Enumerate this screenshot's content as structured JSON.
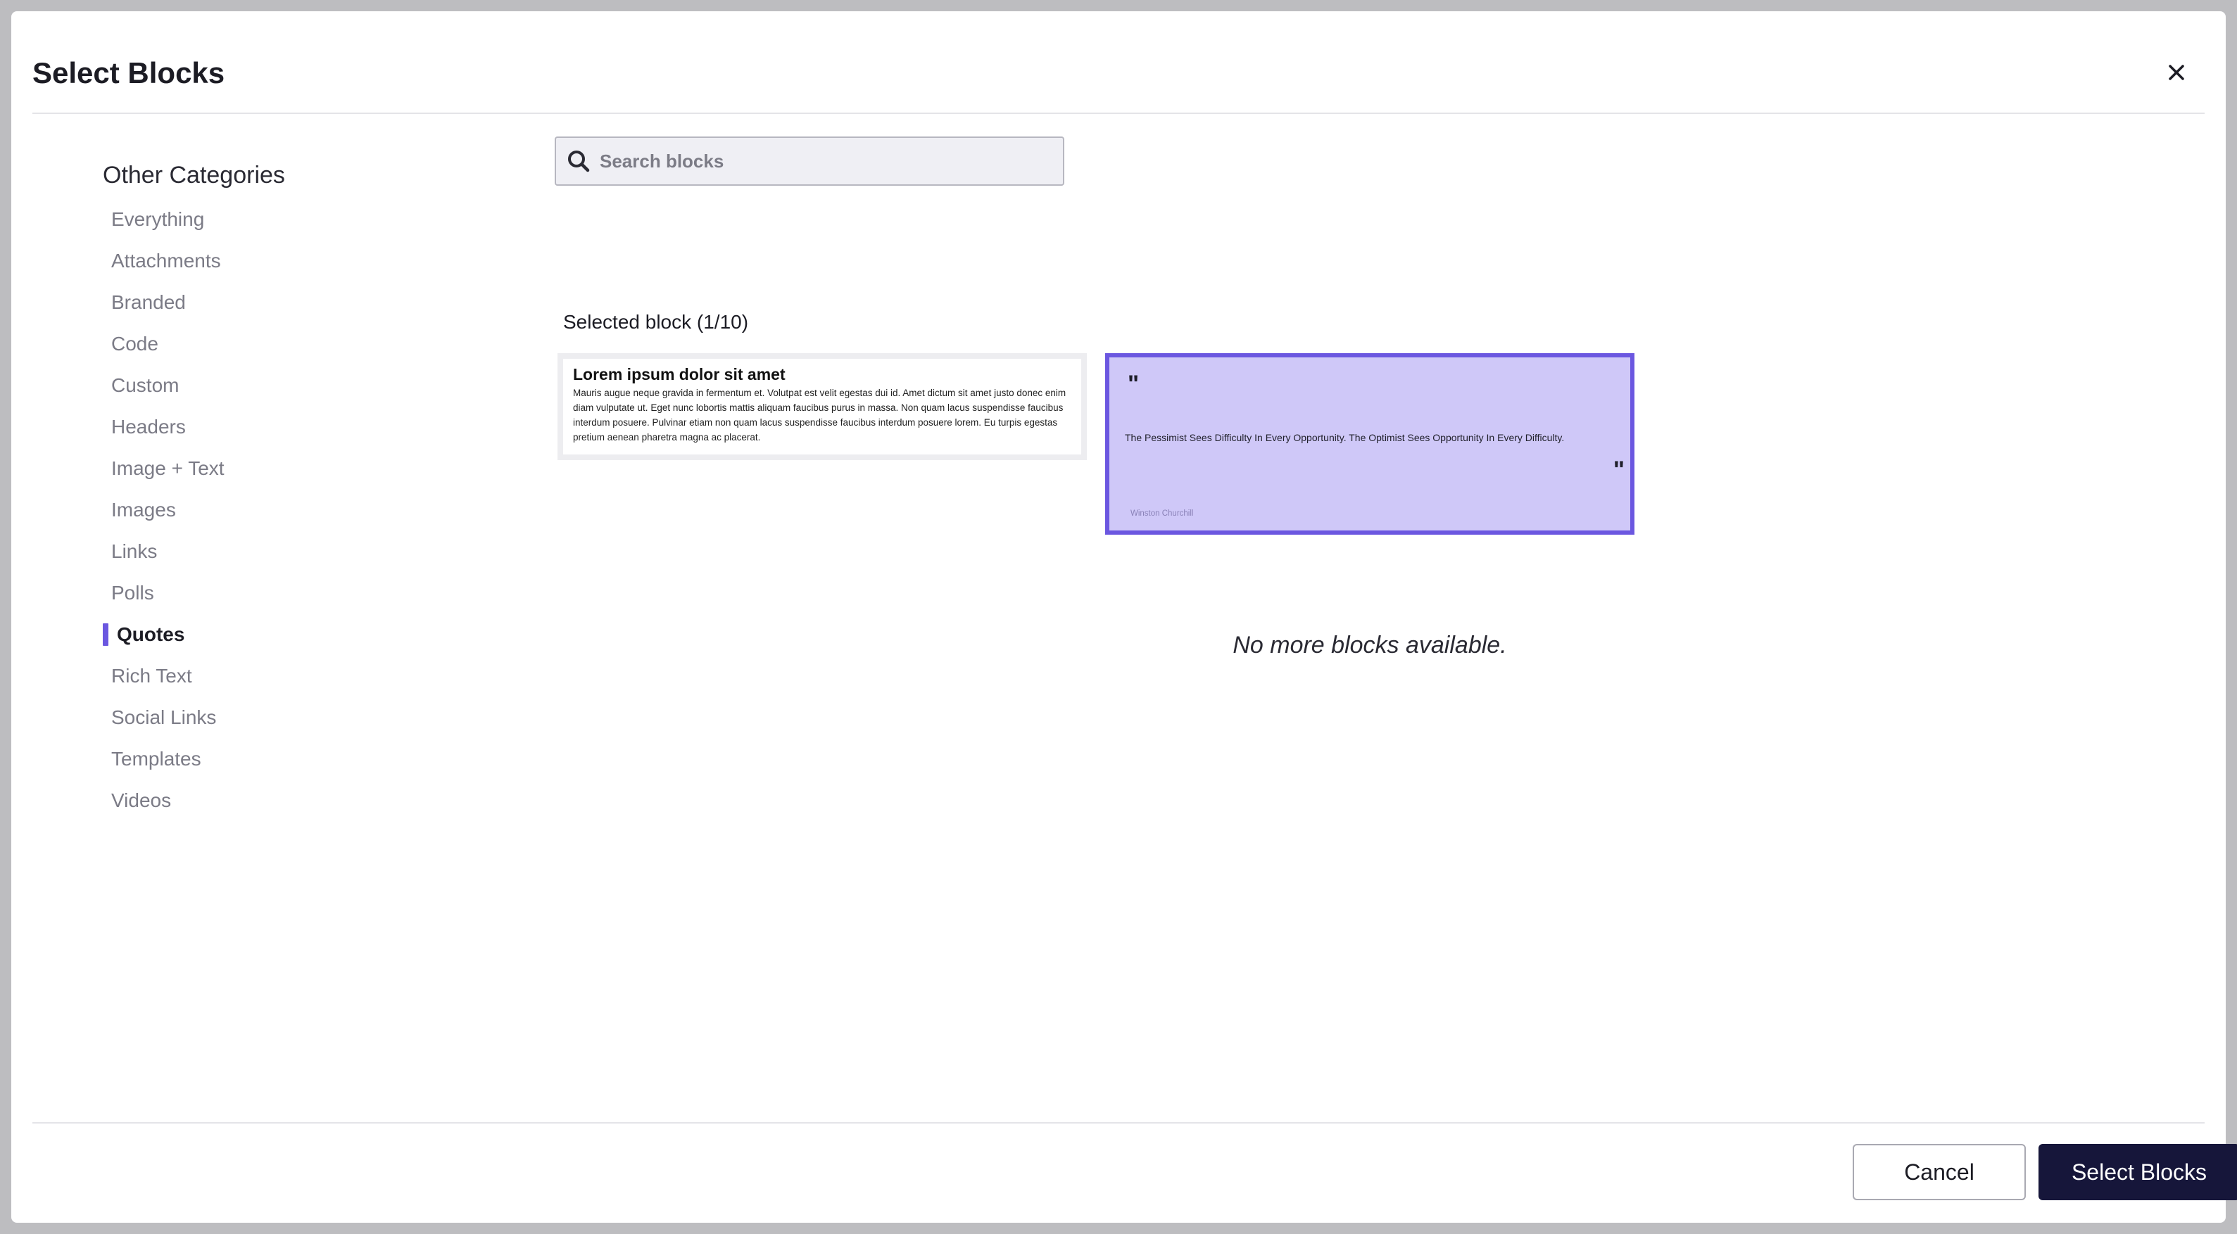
{
  "modal": {
    "title": "Select Blocks",
    "close_icon": "close-icon"
  },
  "sidebar": {
    "heading": "Other Categories",
    "items": [
      {
        "label": "Everything",
        "active": false
      },
      {
        "label": "Attachments",
        "active": false
      },
      {
        "label": "Branded",
        "active": false
      },
      {
        "label": "Code",
        "active": false
      },
      {
        "label": "Custom",
        "active": false
      },
      {
        "label": "Headers",
        "active": false
      },
      {
        "label": "Image + Text",
        "active": false
      },
      {
        "label": "Images",
        "active": false
      },
      {
        "label": "Links",
        "active": false
      },
      {
        "label": "Polls",
        "active": false
      },
      {
        "label": "Quotes",
        "active": true
      },
      {
        "label": "Rich Text",
        "active": false
      },
      {
        "label": "Social Links",
        "active": false
      },
      {
        "label": "Templates",
        "active": false
      },
      {
        "label": "Videos",
        "active": false
      }
    ],
    "active_accent": "#6b57e0"
  },
  "search": {
    "placeholder": "Search blocks",
    "value": "",
    "icon": "search-icon"
  },
  "main": {
    "selected_label": "Selected block (1/10)",
    "blocks": [
      {
        "type": "rich-text",
        "title": "Lorem ipsum dolor sit amet",
        "body": "Mauris augue neque gravida in fermentum et. Volutpat est velit egestas dui id. Amet dictum sit amet justo donec enim diam vulputate ut. Eget nunc lobortis mattis aliquam faucibus purus in massa. Non quam lacus suspendisse faucibus interdum posuere. Pulvinar etiam non quam lacus suspendisse faucibus interdum posuere lorem. Eu turpis egestas pretium aenean pharetra magna ac placerat.",
        "selected": false
      },
      {
        "type": "quote",
        "open_mark": "\"",
        "close_mark": "\"",
        "quote": "The Pessimist Sees Difficulty In Every Opportunity. The Optimist Sees Opportunity In Every Difficulty.",
        "author": "Winston Churchill",
        "selected": true,
        "background": "#cfc8f8",
        "border": "#6b57e0"
      }
    ],
    "empty_message": "No more blocks available."
  },
  "footer": {
    "cancel_label": "Cancel",
    "select_label": "Select Blocks",
    "select_color": "#16163a"
  }
}
